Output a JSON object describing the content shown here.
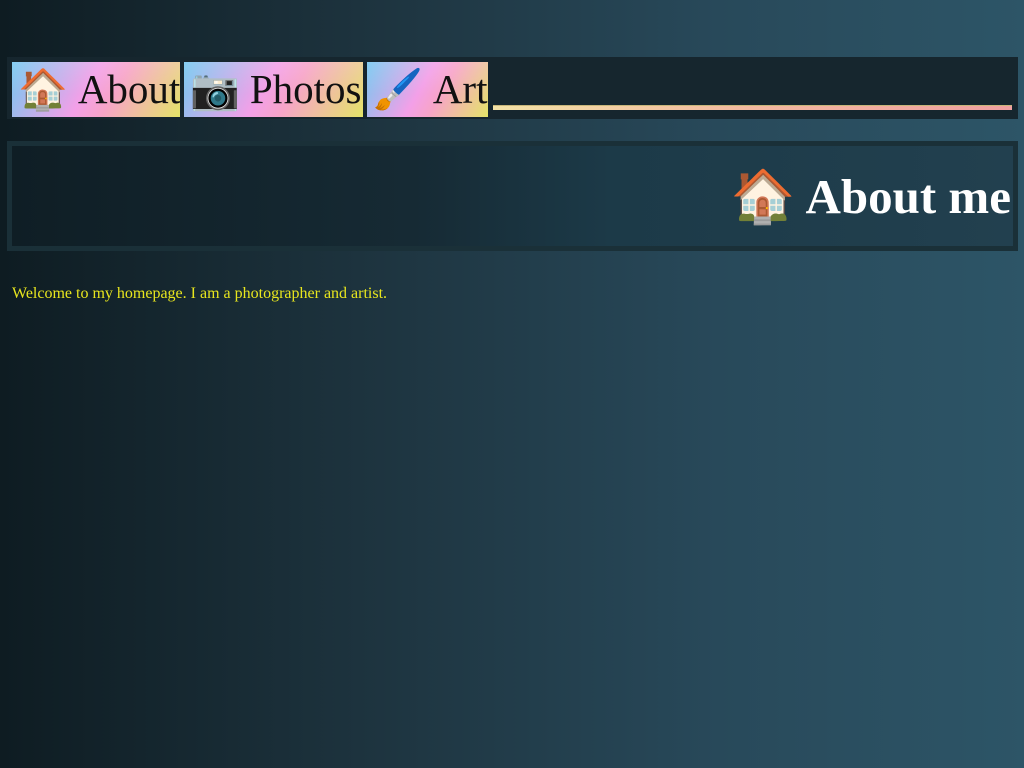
{
  "nav": {
    "tabs": [
      {
        "icon": "🏠",
        "icon_name": "house-icon",
        "label": "About"
      },
      {
        "icon": "📷",
        "icon_name": "camera-icon",
        "label": "Photos"
      },
      {
        "icon": "🖌️",
        "icon_name": "paintbrush-icon",
        "label": "Art"
      }
    ],
    "tab_gradient": [
      "#74c8f0",
      "#f3a0e8",
      "#e4e468"
    ]
  },
  "header": {
    "icon": "🏠",
    "title": "About me"
  },
  "content": {
    "intro": "Welcome to my homepage. I am a photographer and artist."
  },
  "colors": {
    "intro_text": "#e8e61e",
    "title_text": "#ffffff",
    "background_dark": "#0e1c22",
    "background_light": "#2d5567"
  }
}
